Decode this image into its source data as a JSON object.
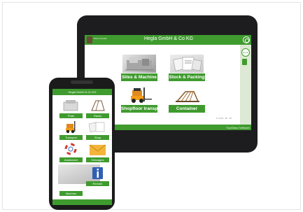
{
  "tablet": {
    "user_name": "Martin Grünwald",
    "app_title": "Hegla GmbH & Co KG",
    "tiles": [
      {
        "label": "Sites & Machine",
        "icon": "machine-photo"
      },
      {
        "label": "Stock & Packing",
        "icon": "packing-photo"
      },
      {
        "label": "Shopfloor transp",
        "icon": "forklift-icon"
      },
      {
        "label": "Container",
        "icon": "container-rack-icon"
      }
    ],
    "home_label": "Home",
    "version": "V. 3.0.0 . 15 . 10",
    "footer_text": "TopGlass Software"
  },
  "phone": {
    "app_title": "Hegla GmbH & Co KG",
    "tiles": [
      {
        "label": "Parts",
        "icon": "parts-icon"
      },
      {
        "label": "Racks",
        "icon": "rack-icon"
      },
      {
        "label": "Transport",
        "icon": "forklift-icon"
      },
      {
        "label": "Shop",
        "icon": "shop-photo"
      },
      {
        "label": "Assistance",
        "icon": "assistance-icon"
      },
      {
        "label": "Messages",
        "icon": "mail-icon"
      },
      {
        "label": "Machine",
        "icon": "machine-photo"
      },
      {
        "label": "Remote",
        "icon": "info-icon"
      }
    ]
  },
  "colors": {
    "brand_green": "#3f9b2e",
    "device_black": "#1d1d1f"
  }
}
